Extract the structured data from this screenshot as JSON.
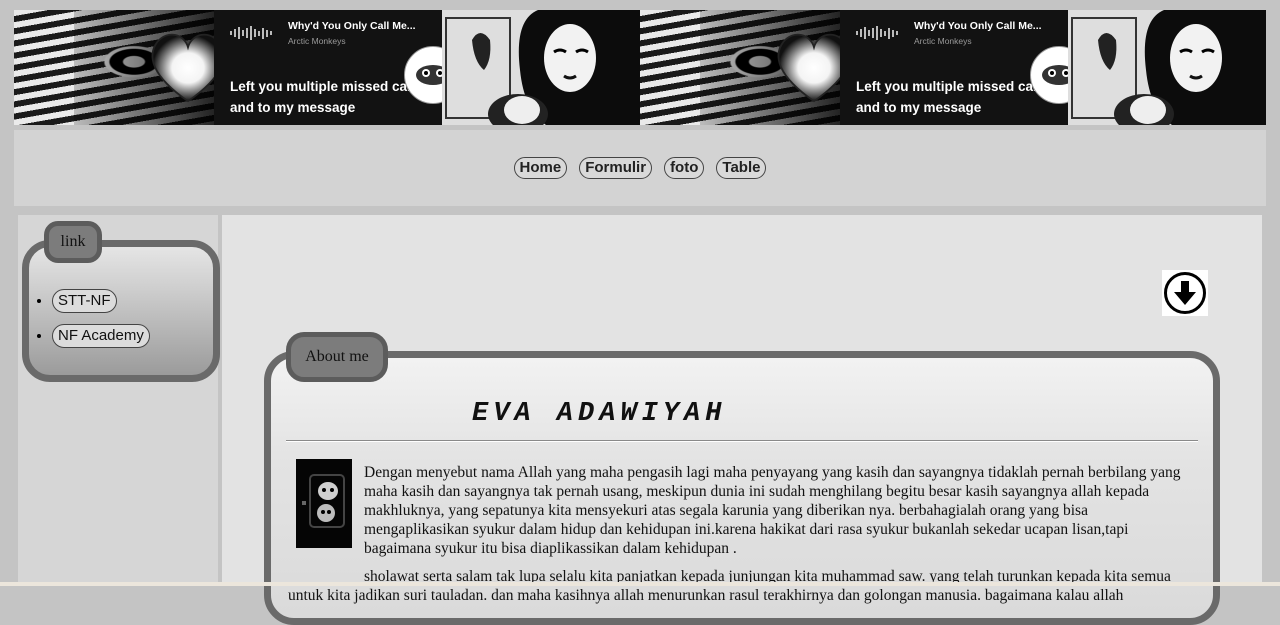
{
  "banner": {
    "song_title": "Why'd You Only Call Me...",
    "artist": "Arctic Monkeys",
    "lyric": "Left you multiple missed calls and to my message"
  },
  "nav": {
    "items": [
      {
        "label": "Home"
      },
      {
        "label": "Formulir"
      },
      {
        "label": "foto"
      },
      {
        "label": "Table"
      }
    ]
  },
  "sidebar": {
    "title": "link",
    "links": [
      {
        "label": "STT-NF"
      },
      {
        "label": "NF Academy"
      }
    ]
  },
  "main": {
    "section_title": "About me",
    "name": "EVA ADAWIYAH",
    "paragraph1": "Dengan menyebut nama Allah yang maha pengasih lagi maha penyayang yang kasih dan sayangnya tidaklah pernah berbilang yang maha kasih dan sayangnya tak pernah usang, meskipun dunia ini sudah menghilang begitu besar kasih sayangnya allah kepada makhluknya, yang sepatunya kita mensyekuri atas segala karunia yang diberikan nya. berbahagialah orang yang bisa mengaplikasikan syukur dalam hidup dan kehidupan ini.karena hakikat dari rasa syukur bukanlah sekedar ucapan lisan,tapi bagaimana syukur itu bisa diaplikassikan dalam kehidupan .",
    "paragraph2": "sholawat serta salam tak lupa selalu kita panjatkan kepada junjungan kita muhammad saw. yang telah turunkan kepada kita semua untuk kita jadikan suri tauladan. dan maha kasihnya allah menurunkan rasul terakhirnya dan golongan manusia. bagaimana kalau allah"
  },
  "icons": {
    "download": "download-icon",
    "heart": "heart-icon"
  }
}
